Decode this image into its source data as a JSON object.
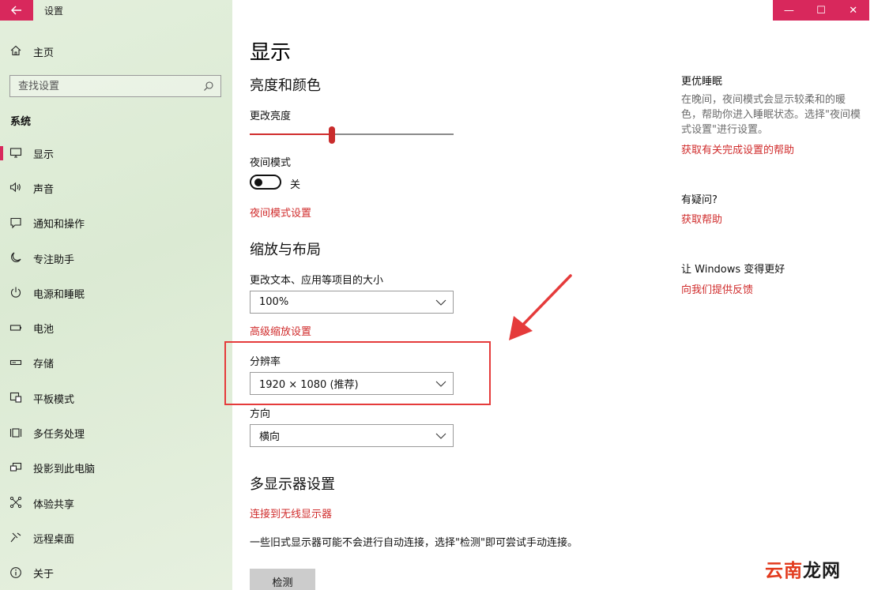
{
  "window": {
    "title": "设置",
    "controls": {
      "minimize": "—",
      "maximize": "☐",
      "close": "✕"
    }
  },
  "colors": {
    "accent": "#d8285c",
    "link": "#d02c2c",
    "sidebar_bg": "#dfecd8",
    "annotation": "#e53b3b"
  },
  "sidebar": {
    "home_label": "主页",
    "search": {
      "placeholder": "查找设置"
    },
    "section_header": "系统",
    "items": [
      {
        "label": "显示",
        "icon": "monitor-icon",
        "selected": true
      },
      {
        "label": "声音",
        "icon": "speaker-icon",
        "selected": false
      },
      {
        "label": "通知和操作",
        "icon": "notification-icon",
        "selected": false
      },
      {
        "label": "专注助手",
        "icon": "moon-icon",
        "selected": false
      },
      {
        "label": "电源和睡眠",
        "icon": "power-icon",
        "selected": false
      },
      {
        "label": "电池",
        "icon": "battery-icon",
        "selected": false
      },
      {
        "label": "存储",
        "icon": "storage-icon",
        "selected": false
      },
      {
        "label": "平板模式",
        "icon": "tablet-icon",
        "selected": false
      },
      {
        "label": "多任务处理",
        "icon": "multitask-icon",
        "selected": false
      },
      {
        "label": "投影到此电脑",
        "icon": "project-icon",
        "selected": false
      },
      {
        "label": "体验共享",
        "icon": "share-icon",
        "selected": false
      },
      {
        "label": "远程桌面",
        "icon": "remote-icon",
        "selected": false
      },
      {
        "label": "关于",
        "icon": "info-icon",
        "selected": false
      }
    ]
  },
  "main": {
    "page_title": "显示",
    "brightness_section": {
      "title": "亮度和颜色",
      "brightness_label": "更改亮度",
      "brightness_value": 0.405,
      "night_mode_label": "夜间模式",
      "night_mode_state": "关",
      "night_mode_link": "夜间模式设置"
    },
    "scale_section": {
      "title": "缩放与布局",
      "scale_label": "更改文本、应用等项目的大小",
      "scale_value": "100%",
      "advanced_link": "高级缩放设置",
      "resolution_label": "分辨率",
      "resolution_value": "1920 × 1080 (推荐)",
      "orientation_label": "方向",
      "orientation_value": "横向"
    },
    "multi_display": {
      "title": "多显示器设置",
      "wireless_link": "连接到无线显示器",
      "description": "一些旧式显示器可能不会进行自动连接，选择\"检测\"即可尝试手动连接。",
      "detect_button": "检测"
    }
  },
  "side_panel": {
    "sleep": {
      "title": "更优睡眠",
      "text": "在晚间，夜间模式会显示较柔和的暖色，帮助你进入睡眠状态。选择\"夜间模式设置\"进行设置。",
      "link": "获取有关完成设置的帮助"
    },
    "question": {
      "title": "有疑问?",
      "link": "获取帮助"
    },
    "feedback": {
      "title": "让 Windows 变得更好",
      "link": "向我们提供反馈"
    }
  },
  "watermark": {
    "part1": "云南",
    "part2": "龙网"
  }
}
